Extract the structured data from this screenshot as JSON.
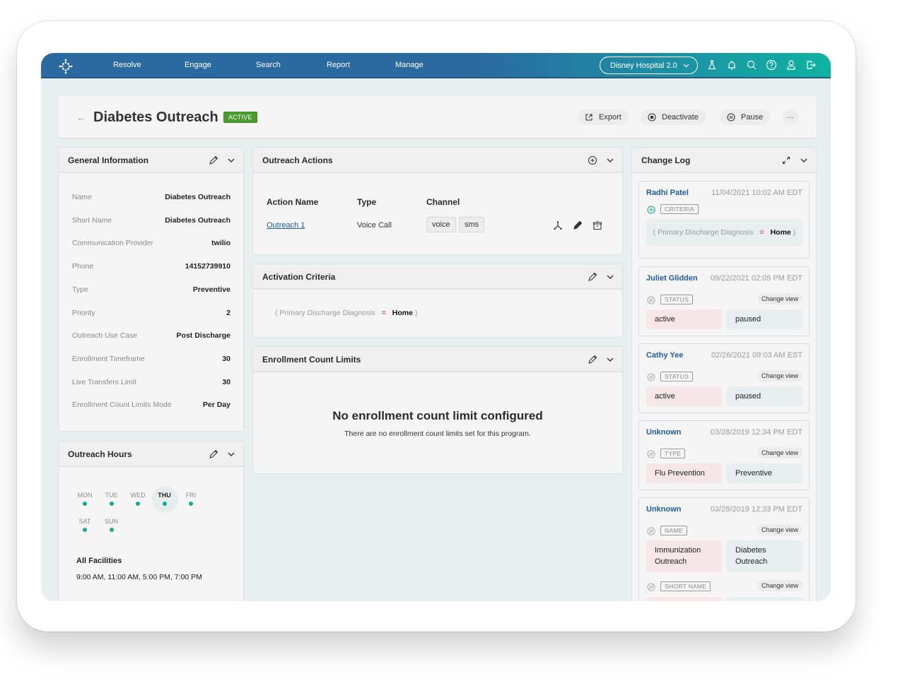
{
  "topbar": {
    "logo_icon": "dotted-diamond-logo",
    "nav": [
      "Resolve",
      "Engage",
      "Search",
      "Report",
      "Manage"
    ],
    "org_selector": "Disney Hospital 2.0",
    "icons": [
      "flask-icon",
      "bell-icon",
      "search-icon",
      "help-icon",
      "user-icon",
      "logout-icon"
    ]
  },
  "header": {
    "back_icon": "arrow-left-icon",
    "title": "Diabetes Outreach",
    "status": "ACTIVE",
    "status_color": "#4a9a2f",
    "buttons": {
      "export": "Export",
      "deactivate": "Deactivate",
      "pause": "Pause",
      "more": "···"
    }
  },
  "general_info": {
    "title": "General Information",
    "rows": [
      {
        "label": "Name",
        "value": "Diabetes Outreach"
      },
      {
        "label": "Short Name",
        "value": "Diabetes Outreach"
      },
      {
        "label": "Communication Provider",
        "value": "twilio"
      },
      {
        "label": "Phone",
        "value": "14152739910"
      },
      {
        "label": "Type",
        "value": "Preventive"
      },
      {
        "label": "Priority",
        "value": "2"
      },
      {
        "label": "Outreach Use Case",
        "value": "Post Discharge"
      },
      {
        "label": "Enrollment Timeframe",
        "value": "30"
      },
      {
        "label": "Live Transfers Limit",
        "value": "30"
      },
      {
        "label": "Enrollment Count Limits Mode",
        "value": "Per Day"
      }
    ]
  },
  "outreach_hours": {
    "title": "Outreach Hours",
    "days": [
      {
        "label": "MON",
        "active": false
      },
      {
        "label": "TUE",
        "active": false
      },
      {
        "label": "WED",
        "active": false
      },
      {
        "label": "THU",
        "active": true
      },
      {
        "label": "FRI",
        "active": false
      },
      {
        "label": "SAT",
        "active": false
      },
      {
        "label": "SUN",
        "active": false
      }
    ],
    "facility": "All Facilities",
    "times": "9:00 AM, 11:00 AM, 5:00 PM, 7:00 PM"
  },
  "outreach_actions": {
    "title": "Outreach Actions",
    "columns": [
      "Action Name",
      "Type",
      "Channel"
    ],
    "rows": [
      {
        "name": "Outreach 1",
        "type": "Voice Call",
        "channels": [
          "voice",
          "sms"
        ]
      }
    ]
  },
  "activation_criteria": {
    "title": "Activation Criteria",
    "field": "Primary Discharge Diagnosis",
    "operator": "=",
    "value": "Home"
  },
  "enrollment_limits": {
    "title": "Enrollment Count Limits",
    "empty_title": "No enrollment count limit configured",
    "empty_text": "There are no enrollment count limits set for this program."
  },
  "change_log": {
    "title": "Change Log",
    "change_view": "Change view",
    "entries": [
      {
        "user": "Radhi Patel",
        "time": "11/04/2021 10:02 AM EDT",
        "tag": "CRITERIA",
        "criteria_field": "Primary Discharge Diagnosis",
        "criteria_op": "=",
        "criteria_value": "Home"
      },
      {
        "user": "Juliet Glidden",
        "time": "09/22/2021 02:05 PM EDT",
        "tag": "STATUS",
        "old": "active",
        "new": "paused"
      },
      {
        "user": "Cathy Yee",
        "time": "02/26/2021 09:03 AM EST",
        "tag": "STATUS",
        "old": "active",
        "new": "paused"
      },
      {
        "user": "Unknown",
        "time": "03/28/2019 12:34 PM EDT",
        "tag": "TYPE",
        "old": "Flu Prevention",
        "new": "Preventive"
      },
      {
        "user": "Unknown",
        "time": "03/28/2019 12:33 PM EDT",
        "tag": "NAME",
        "old": "Immunization Outreach",
        "new": "Diabetes Outreach",
        "tag2": "SHORT NAME"
      }
    ]
  }
}
